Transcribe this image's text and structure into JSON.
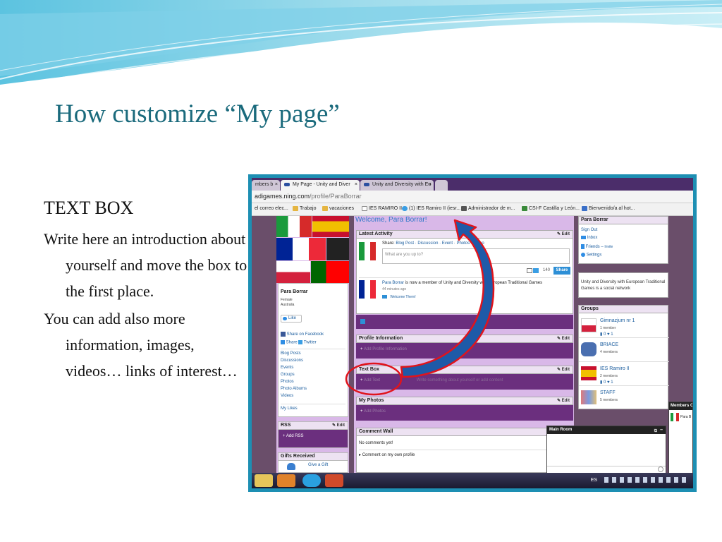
{
  "slide": {
    "title": "How customize “My page”",
    "heading": "TEXT BOX",
    "para1": "Write here an introduction about yourself and move the box to the first place.",
    "para2": "You can add also more information, images, videos… links of interest…"
  },
  "browser": {
    "tabs": [
      "mbers b",
      "My Page - Unity and Diver",
      "Unity and Diversity with Eu"
    ],
    "tab_close": "×",
    "address": "adigames.ning.com",
    "address_path": "/profile/ParaBorrar",
    "bookmarks": [
      "el correo elec...",
      "Trabajo",
      "vacaciones",
      "IES RAMIRO II",
      "(1) IES Ramiro II (iesr...",
      "Administrador de m...",
      "CSI-F Castilla y León...",
      "Bienvenido/a al hot..."
    ]
  },
  "left": {
    "profile_name": "Para Borrar",
    "gender": "Female",
    "country": "Australia",
    "like": "Like",
    "share_facebook": "Share on Facebook",
    "share": "Share",
    "twitter": "Twitter",
    "links": [
      "Blog Posts",
      "Discussions",
      "Events",
      "Groups",
      "Photos",
      "Photo Albums",
      "Videos"
    ],
    "my_likes": "My Likes",
    "rss_title": "RSS",
    "rss_add": "Add RSS",
    "gifts_title": "Gifts Received",
    "give_gift": "Give a Gift",
    "edit": "Edit"
  },
  "main": {
    "welcome": "Welcome, Para Borrar!",
    "latest_activity": "Latest Activity",
    "share_label": "Share:",
    "share_blog": "Blog Post",
    "share_discussion": "Discussion",
    "share_event": "Event",
    "share_photos": "Photos",
    "share_video": "Video",
    "status_placeholder": "What are you up to?",
    "char_count": "140",
    "share_button": "Share",
    "activity_name": "Para Borrar",
    "activity_text": "is now a member of Unity and Diversity with European Traditional Games",
    "activity_time": "44 minutes ago",
    "welcome_them": "Welcome Them!",
    "profile_information": "Profile Information",
    "profile_add": "Add Profile Information",
    "text_box": "Text Box",
    "text_box_add": "Add Text",
    "text_box_hint": "Write something about yourself or add content",
    "my_photos": "My Photos",
    "photos_add": "Add Photos",
    "comment_wall": "Comment Wall",
    "no_comments": "No comments yet!",
    "comment_own": "Comment on my own profile",
    "edit": "Edit"
  },
  "right": {
    "profile_name": "Para Borrar",
    "sign_out": "Sign Out",
    "inbox": "Inbox",
    "friends": "Friends",
    "invite": "Invite",
    "settings": "Settings",
    "network_desc": "Unity and Diversity with European Traditional Games is a social network",
    "groups_title": "Groups",
    "groups": [
      {
        "name": "Gimnazjum nr 1",
        "members": "1 member",
        "a": "0",
        "b": "1"
      },
      {
        "name": "BRIACE",
        "members": "4 members"
      },
      {
        "name": "IES Ramiro II",
        "members": "2 members",
        "a": "0",
        "b": "1"
      },
      {
        "name": "STAFF",
        "members": "5 members"
      }
    ],
    "main_room": "Main Room",
    "members_title": "Members O",
    "member_name": "Para B"
  },
  "taskbar": {
    "lang": "ES"
  },
  "colors": {
    "title": "#1a6a7c",
    "frame": "#1d8fb3",
    "network_purple": "#6b2f7e",
    "arrow_outline": "#e0141c",
    "arrow_fill": "#1e5aa8"
  }
}
